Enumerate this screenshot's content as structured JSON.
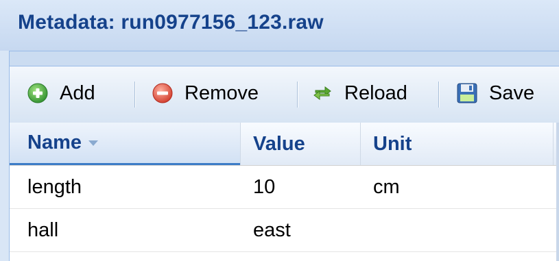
{
  "panel": {
    "title": "Metadata: run0977156_123.raw"
  },
  "toolbar": {
    "add_label": "Add",
    "remove_label": "Remove",
    "reload_label": "Reload",
    "save_label": "Save"
  },
  "grid": {
    "columns": [
      {
        "label": "Name",
        "sorted": "desc"
      },
      {
        "label": "Value"
      },
      {
        "label": "Unit"
      }
    ],
    "rows": [
      {
        "name": "length",
        "value": "10",
        "unit": "cm"
      },
      {
        "name": "hall",
        "value": "east",
        "unit": ""
      }
    ]
  },
  "icons": {
    "add": "plus-circle-icon",
    "remove": "minus-circle-icon",
    "reload": "reload-arrows-icon",
    "save": "floppy-disk-icon"
  },
  "colors": {
    "title": "#15428b",
    "add_green": "#3ea83e",
    "remove_red": "#e04a3a",
    "reload_green": "#5aa832",
    "save_blue": "#3a6fb6"
  }
}
